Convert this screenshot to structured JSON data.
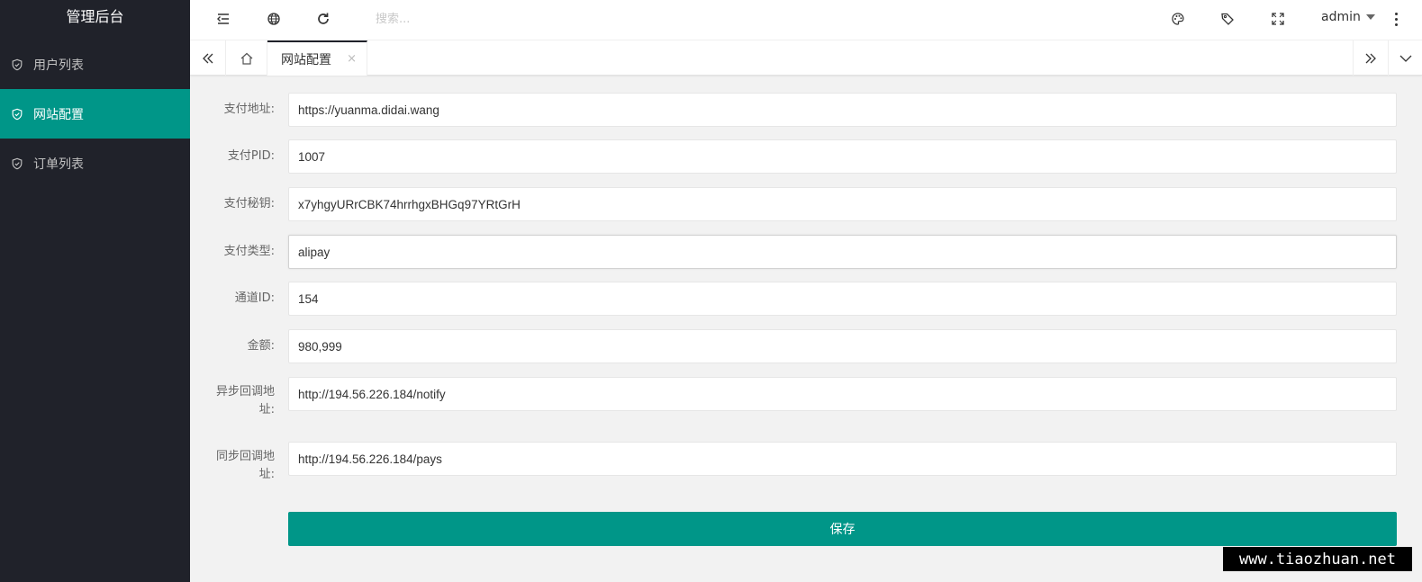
{
  "app": {
    "title": "管理后台"
  },
  "sidebar": {
    "items": [
      {
        "label": "用户列表",
        "active": false,
        "icon": "shield-check-icon"
      },
      {
        "label": "网站配置",
        "active": true,
        "icon": "shield-check-icon"
      },
      {
        "label": "订单列表",
        "active": false,
        "icon": "shield-check-icon"
      }
    ]
  },
  "header": {
    "search_placeholder": "搜索...",
    "user": "admin",
    "icons": [
      "menu-fold-icon",
      "globe-icon",
      "refresh-icon",
      "theme-palette-icon",
      "tag-icon",
      "fullscreen-icon",
      "more-vertical-icon"
    ]
  },
  "tabs": {
    "items": [
      {
        "label": "网站配置",
        "close": "×"
      }
    ],
    "icons": [
      "double-chevron-left-icon",
      "home-icon",
      "double-chevron-right-icon",
      "chevron-down-icon"
    ]
  },
  "form": {
    "fields": [
      {
        "label": "支付地址:",
        "value": "https://yuanma.didai.wang"
      },
      {
        "label": "支付PID:",
        "value": "1007"
      },
      {
        "label": "支付秘钥:",
        "value": "x7yhgyURrCBK74hrrhgxBHGq97YRtGrH"
      },
      {
        "label": "支付类型:",
        "value": "alipay"
      },
      {
        "label": "通道ID:",
        "value": "154"
      },
      {
        "label": "金额:",
        "value": "980,999"
      },
      {
        "label": "异步回调地址:",
        "value": "http://194.56.226.184/notify"
      },
      {
        "label": "同步回调地址:",
        "value": "http://194.56.226.184/pays"
      }
    ],
    "save_label": "保存"
  },
  "watermark": "www.tiaozhuan.net",
  "colors": {
    "accent": "#009688",
    "sidebar_bg": "#20222a",
    "page_bg": "#f2f2f2"
  }
}
